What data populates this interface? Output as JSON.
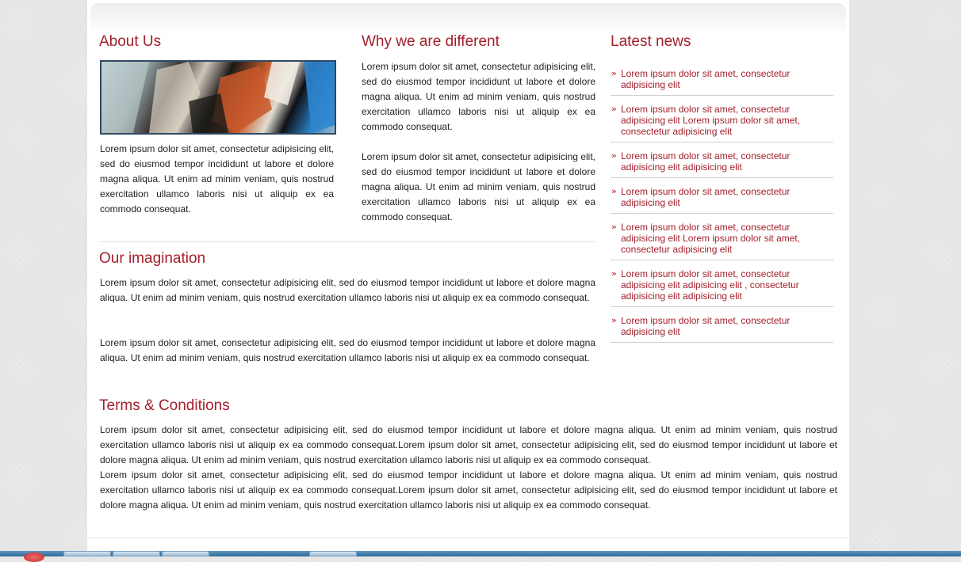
{
  "about": {
    "heading": "About Us",
    "text": "Lorem ipsum dolor sit amet, consectetur adipisicing elit, sed do eiusmod tempor incididunt ut labore et dolore magna aliqua. Ut enim ad minim veniam, quis nostrud exercitation ullamco laboris nisi ut aliquip ex ea commodo consequat."
  },
  "different": {
    "heading": "Why we are different",
    "paragraphs": [
      "Lorem ipsum dolor sit amet, consectetur adipisicing elit, sed do eiusmod tempor incididunt ut labore et dolore magna aliqua. Ut enim ad minim veniam, quis nostrud exercitation ullamco laboris nisi ut aliquip ex ea commodo consequat.",
      "Lorem ipsum dolor sit amet, consectetur adipisicing elit, sed do eiusmod tempor incididunt ut labore et dolore magna aliqua. Ut enim ad minim veniam, quis nostrud exercitation ullamco laboris nisi ut aliquip ex ea commodo consequat."
    ]
  },
  "news": {
    "heading": "Latest news",
    "items": [
      "Lorem ipsum dolor sit amet, consectetur adipisicing elit",
      "Lorem ipsum dolor sit amet, consectetur adipisicing elit Lorem ipsum dolor sit amet, consectetur adipisicing elit",
      "Lorem ipsum dolor sit amet, consectetur adipisicing elit adipisicing elit",
      "Lorem ipsum dolor sit amet, consectetur adipisicing elit",
      "Lorem ipsum dolor sit amet, consectetur adipisicing elit Lorem ipsum dolor sit amet, consectetur adipisicing elit",
      "Lorem ipsum dolor sit amet, consectetur adipisicing elit adipisicing elit , consectetur adipisicing elit adipisicing elit",
      "Lorem ipsum dolor sit amet, consectetur adipisicing elit"
    ]
  },
  "imagination": {
    "heading": "Our imagination",
    "paragraphs": [
      "Lorem ipsum dolor sit amet, consectetur adipisicing elit, sed do eiusmod tempor incididunt ut labore et dolore magna aliqua. Ut enim ad minim veniam, quis nostrud exercitation ullamco laboris nisi ut aliquip ex ea commodo consequat.",
      "Lorem ipsum dolor sit amet, consectetur adipisicing elit, sed do eiusmod tempor incididunt ut labore et dolore magna aliqua. Ut enim ad minim veniam, quis nostrud exercitation ullamco laboris nisi ut aliquip ex ea commodo consequat."
    ]
  },
  "terms": {
    "heading": "Terms & Conditions",
    "paragraphs": [
      "Lorem ipsum dolor sit amet, consectetur adipisicing elit, sed do eiusmod tempor incididunt ut labore et dolore magna aliqua. Ut enim ad minim veniam, quis nostrud exercitation ullamco laboris nisi ut aliquip ex ea commodo consequat.Lorem ipsum dolor sit amet, consectetur adipisicing elit, sed do eiusmod tempor incididunt ut labore et dolore magna aliqua. Ut enim ad minim veniam, quis nostrud exercitation ullamco laboris nisi ut aliquip ex ea commodo consequat.",
      "Lorem ipsum dolor sit amet, consectetur adipisicing elit, sed do eiusmod tempor incididunt ut labore et dolore magna aliqua. Ut enim ad minim veniam, quis nostrud exercitation ullamco laboris nisi ut aliquip ex ea commodo consequat.Lorem ipsum dolor sit amet, consectetur adipisicing elit, sed do eiusmod tempor incididunt ut labore et dolore magna aliqua. Ut enim ad minim veniam, quis nostrud exercitation ullamco laboris nisi ut aliquip ex ea commodo consequat."
    ]
  },
  "colors": {
    "accent": "#a3202c",
    "text": "#222222",
    "taskbar": "#2f6c9a"
  },
  "icons": {
    "news_bullet": "double-chevron-right-icon"
  }
}
